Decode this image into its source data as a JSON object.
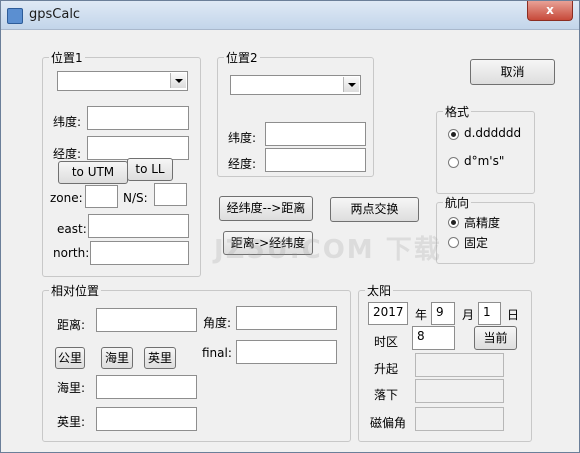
{
  "window": {
    "title": "gpsCalc",
    "close_label": "x"
  },
  "pos1": {
    "group_label": "位置1",
    "lat_label": "纬度:",
    "lon_label": "经度:",
    "to_utm_label": "to UTM",
    "to_ll_label": "to LL",
    "zone_label": "zone:",
    "ns_label": "N/S:",
    "east_label": "east:",
    "north_label": "north:"
  },
  "pos2": {
    "group_label": "位置2",
    "lat_label": "纬度:",
    "lon_label": "经度:"
  },
  "buttons": {
    "cancel": "取消",
    "ll_to_dist": "经纬度-->距离",
    "swap": "两点交换",
    "dist_to_ll": "距离->经纬度"
  },
  "format": {
    "group_label": "格式",
    "opt1": "d.dddddd",
    "opt2": "d°m's\""
  },
  "heading": {
    "group_label": "航向",
    "opt1": "高精度",
    "opt2": "固定"
  },
  "relative": {
    "group_label": "相对位置",
    "dist_label": "距离:",
    "angle_label": "角度:",
    "km_btn": "公里",
    "nmi_btn": "海里",
    "mile_btn": "英里",
    "final_label": "final:",
    "nmi_label": "海里:",
    "mile_label": "英里:"
  },
  "sun": {
    "group_label": "太阳",
    "year": "2017",
    "year_label": "年",
    "month": "9",
    "month_label": "月",
    "day": "1",
    "day_label": "日",
    "tz_label": "时区",
    "tz_value": "8",
    "now_btn": "当前",
    "rise_label": "升起",
    "set_label": "落下",
    "magdec_label": "磁偏角"
  },
  "watermark": "JZ5U.COM 下载"
}
